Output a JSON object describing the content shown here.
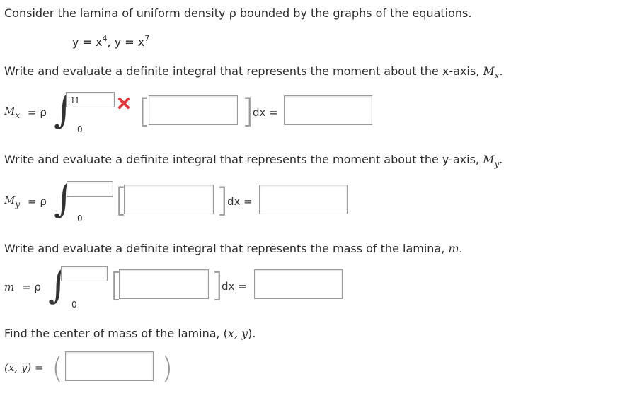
{
  "intro": "Consider the lamina of uniform density ρ bounded by the graphs of the equations.",
  "equations": {
    "eq1_lhs": "y = x",
    "eq1_exp": "4",
    "sep": ", ",
    "eq2_lhs": "y = x",
    "eq2_exp": "7"
  },
  "mx_section": {
    "prompt_text": "Write and evaluate a definite integral that represents the moment about the x-axis, ",
    "prompt_sym": "M",
    "prompt_sub": "x",
    "prompt_end": ".",
    "lhs_sym": "M",
    "lhs_sub": "x",
    "equals_rho": "=  ρ",
    "lower_limit": "0",
    "upper_limit_value": "11",
    "upper_limit_status": "incorrect",
    "dx": "dx ="
  },
  "my_section": {
    "prompt_text": "Write and evaluate a definite integral that represents the moment about the y-axis, ",
    "prompt_sym": "M",
    "prompt_sub": "y",
    "prompt_end": ".",
    "lhs_sym": "M",
    "lhs_sub": "y",
    "equals_rho": "=  ρ",
    "lower_limit": "0",
    "dx": "dx ="
  },
  "mass_section": {
    "prompt_text": "Write and evaluate a definite integral that represents the mass of the lamina, ",
    "prompt_sym": "m",
    "prompt_end": ".",
    "lhs_sym": "m",
    "equals_rho": "=  ρ",
    "lower_limit": "0",
    "dx": "dx ="
  },
  "center_section": {
    "prompt_text": "Find the center of mass of the lamina, (",
    "prompt_sym": "x̅, y̅",
    "prompt_end": ").",
    "lhs": "(x̅, y̅) ="
  },
  "colors": {
    "error": "#e0393e",
    "border": "#9a9a9a"
  },
  "icons": {
    "incorrect": "x-mark-icon"
  }
}
